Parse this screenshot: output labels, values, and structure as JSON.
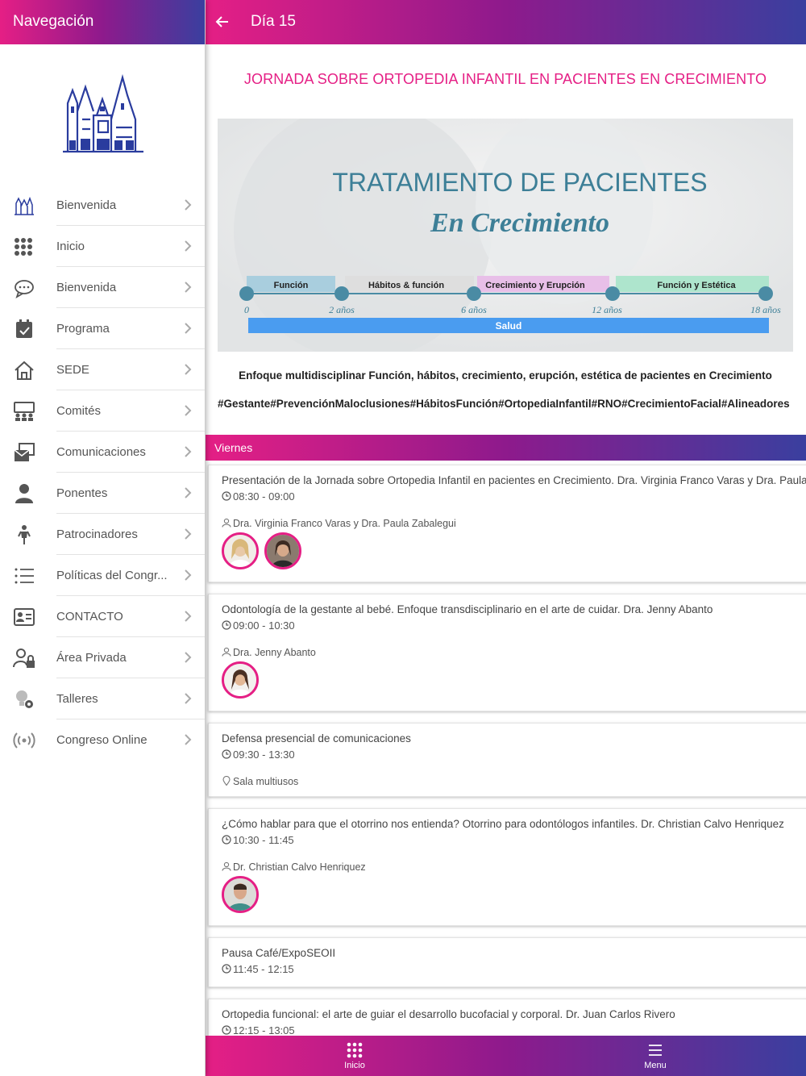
{
  "sidebar": {
    "title": "Navegación",
    "items": [
      {
        "label": "Bienvenida",
        "icon": "cathedral-icon"
      },
      {
        "label": "Inicio",
        "icon": "grid-icon"
      },
      {
        "label": "Bienvenida",
        "icon": "chat-icon"
      },
      {
        "label": "Programa",
        "icon": "calendar-icon"
      },
      {
        "label": "SEDE",
        "icon": "home-icon"
      },
      {
        "label": "Comités",
        "icon": "committee-icon"
      },
      {
        "label": "Comunicaciones",
        "icon": "communications-icon"
      },
      {
        "label": "Ponentes",
        "icon": "person-icon"
      },
      {
        "label": "Patrocinadores",
        "icon": "figure-icon"
      },
      {
        "label": "Políticas del Congr...",
        "icon": "list-icon"
      },
      {
        "label": "CONTACTO",
        "icon": "contact-card-icon"
      },
      {
        "label": "Área Privada",
        "icon": "user-lock-icon"
      },
      {
        "label": "Talleres",
        "icon": "bulb-gear-icon"
      },
      {
        "label": "Congreso Online",
        "icon": "broadcast-icon"
      }
    ]
  },
  "header": {
    "title": "Día 15"
  },
  "event": {
    "title": "JORNADA SOBRE ORTOPEDIA INFANTIL EN PACIENTES EN CRECIMIENTO",
    "banner": {
      "heading": "TRATAMIENTO DE PACIENTES",
      "subheading": "En Crecimiento",
      "stages": [
        "Función",
        "Hábitos & función",
        "Crecimiento y Erupción",
        "Función y Estética"
      ],
      "ages": [
        "0",
        "2 años",
        "6 años",
        "12 años",
        "18 años"
      ],
      "bar": "Salud"
    },
    "description": "Enfoque multidisciplinar Función, hábitos, crecimiento, erupción, estética de pacientes en Crecimiento",
    "hashtags": "#Gestante#PrevenciónMaloclusiones#HábitosFunción#OrtopediaInfantil#RNO#CrecimientoFacial#Alineadores"
  },
  "day_section": "Viernes",
  "sessions": [
    {
      "title": "Presentación de la Jornada sobre Ortopedia Infantil en pacientes en Crecimiento. Dra. Virginia Franco Varas y Dra. Paula Zabalegui",
      "time": "08:30 - 09:00",
      "speakers": "Dra. Virginia Franco Varas y Dra. Paula Zabalegui"
    },
    {
      "title": "Odontología de la gestante al bebé. Enfoque transdisciplinario en el arte de cuidar. Dra. Jenny Abanto",
      "time": "09:00 - 10:30",
      "speakers": "Dra. Jenny Abanto"
    },
    {
      "title": "Defensa presencial de comunicaciones",
      "time": "09:30 - 13:30",
      "location": "Sala multiusos"
    },
    {
      "title": "¿Cómo hablar para que el otorrino nos entienda? Otorrino para odontólogos infantiles. Dr. Christian Calvo Henriquez",
      "time": "10:30 - 11:45",
      "speakers": "Dr. Christian Calvo Henriquez"
    },
    {
      "title": "Pausa Café/ExpoSEOII",
      "time": "11:45 - 12:15"
    },
    {
      "title": "Ortopedia funcional: el arte de guiar el desarrollo bucofacial y corporal. Dr. Juan Carlos Rivero",
      "time": "12:15 - 13:05"
    }
  ],
  "bottom_nav": {
    "home_label": "Inicio",
    "menu_label": "Menu"
  }
}
